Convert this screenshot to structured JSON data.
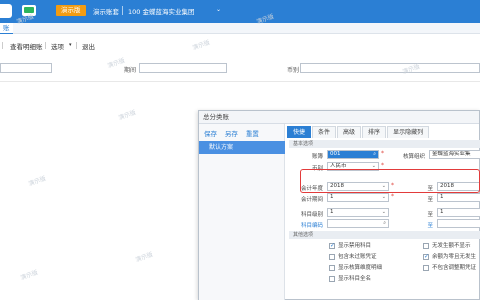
{
  "topbar": {
    "demo_badge": "演示版",
    "demo_account": "演示账套",
    "org": "100 金蝶蓝海实业集团",
    "brand_color": "#2b7fd4",
    "badge_color": "#f39c12"
  },
  "subtab": {
    "label": "账"
  },
  "toolbar": {
    "detail_btn": "查看明细账",
    "options_btn": "选项",
    "exit_btn": "退出"
  },
  "filter": {
    "period_label": "期间",
    "currency_label": "币别"
  },
  "watermark": "演示版",
  "dialog": {
    "title": "总分类账",
    "left": {
      "save": "保存",
      "save_as": "另存",
      "reset": "重置",
      "scheme": "默认方案"
    },
    "tabs": [
      "快捷",
      "条件",
      "高级",
      "排序",
      "显示隐藏列"
    ],
    "basic_section": "基本选项",
    "other_section": "其他选项",
    "fields": {
      "book_label": "账簿",
      "book_value": "001",
      "org_label": "核算组织",
      "org_value": "金蝶蓝海实业集",
      "currency_label": "币别",
      "currency_value": "人民币",
      "year_label": "会计年度",
      "year_from": "2018",
      "year_to_label": "至",
      "year_to": "2018",
      "period_label": "会计期间",
      "period_from": "1",
      "period_to_label": "至",
      "period_to": "1",
      "level_label": "科目级别",
      "level_from": "1",
      "level_to_label": "至",
      "level_to": "1",
      "code_label": "科目编码",
      "code_to_label": "至"
    },
    "checks": [
      {
        "label": "显示禁用科目",
        "checked": true
      },
      {
        "label": "无发生额不显示",
        "checked": false
      },
      {
        "label": "包含未过账凭证",
        "checked": false
      },
      {
        "label": "余额为零且无发生",
        "checked": true
      },
      {
        "label": "显示核算维度明细",
        "checked": false
      },
      {
        "label": "不包含调整期凭证",
        "checked": false
      },
      {
        "label": "显示科目全名",
        "checked": false
      }
    ]
  }
}
